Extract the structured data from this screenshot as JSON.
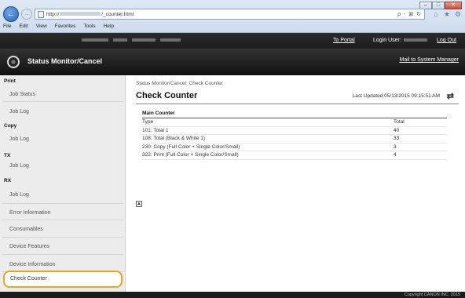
{
  "browser": {
    "url_prefix": "http://",
    "url_suffix": "/_counter.html",
    "address_tools": "ρ - ⊠ ↻",
    "menu": [
      "File",
      "Edit",
      "View",
      "Favorites",
      "Tools",
      "Help"
    ]
  },
  "header": {
    "to_portal": "To Portal",
    "login_user_label": "Login User:",
    "log_out": "Log Out",
    "app_title": "Status Monitor/Cancel",
    "mail_to_system_manager": "Mail to System Manager"
  },
  "sidebar": {
    "sections": [
      {
        "heading": "Print",
        "items": [
          "Job Status",
          "Job Log"
        ]
      },
      {
        "heading": "Copy",
        "items": [
          "Job Log"
        ]
      },
      {
        "heading": "TX",
        "items": [
          "Job Log"
        ]
      },
      {
        "heading": "RX",
        "items": [
          "Job Log"
        ]
      }
    ],
    "links": [
      "Error Information",
      "Consumables",
      "Device Features",
      "Device Information",
      "Check Counter"
    ]
  },
  "content": {
    "breadcrumb": "Status Monitor/Cancel: Check Counter",
    "title": "Check Counter",
    "last_updated": "Last Updated:05/13/2015 09:15:51 AM",
    "section_title": "Main Counter",
    "columns": [
      "Type",
      "Total"
    ],
    "rows": [
      [
        "101: Total 1",
        "40"
      ],
      [
        "108: Total (Black & White 1)",
        "33"
      ],
      [
        "230: Copy (Full Color + Single Color/Small)",
        "3"
      ],
      [
        "322: Print (Full Color + Single Color/Small)",
        "4"
      ]
    ]
  },
  "footer": {
    "copyright": "Copyright CANON INC. 2015"
  },
  "colors": {
    "highlight_ring": "#f0a31b",
    "header_bg": "#202020"
  }
}
